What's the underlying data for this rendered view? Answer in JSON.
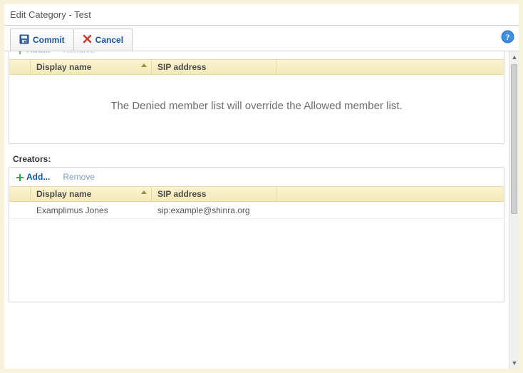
{
  "window": {
    "title": "Edit Category - Test"
  },
  "toolbar": {
    "commit_label": "Commit",
    "cancel_label": "Cancel"
  },
  "columns": {
    "display_name": "Display name",
    "sip_address": "SIP address"
  },
  "actions": {
    "add": "Add...",
    "remove": "Remove"
  },
  "denied": {
    "info": "The Denied member list will override the Allowed member list."
  },
  "creators": {
    "label": "Creators:",
    "rows": [
      {
        "display_name": "Examplimus Jones",
        "sip": "sip:example@shinra.org"
      }
    ]
  }
}
